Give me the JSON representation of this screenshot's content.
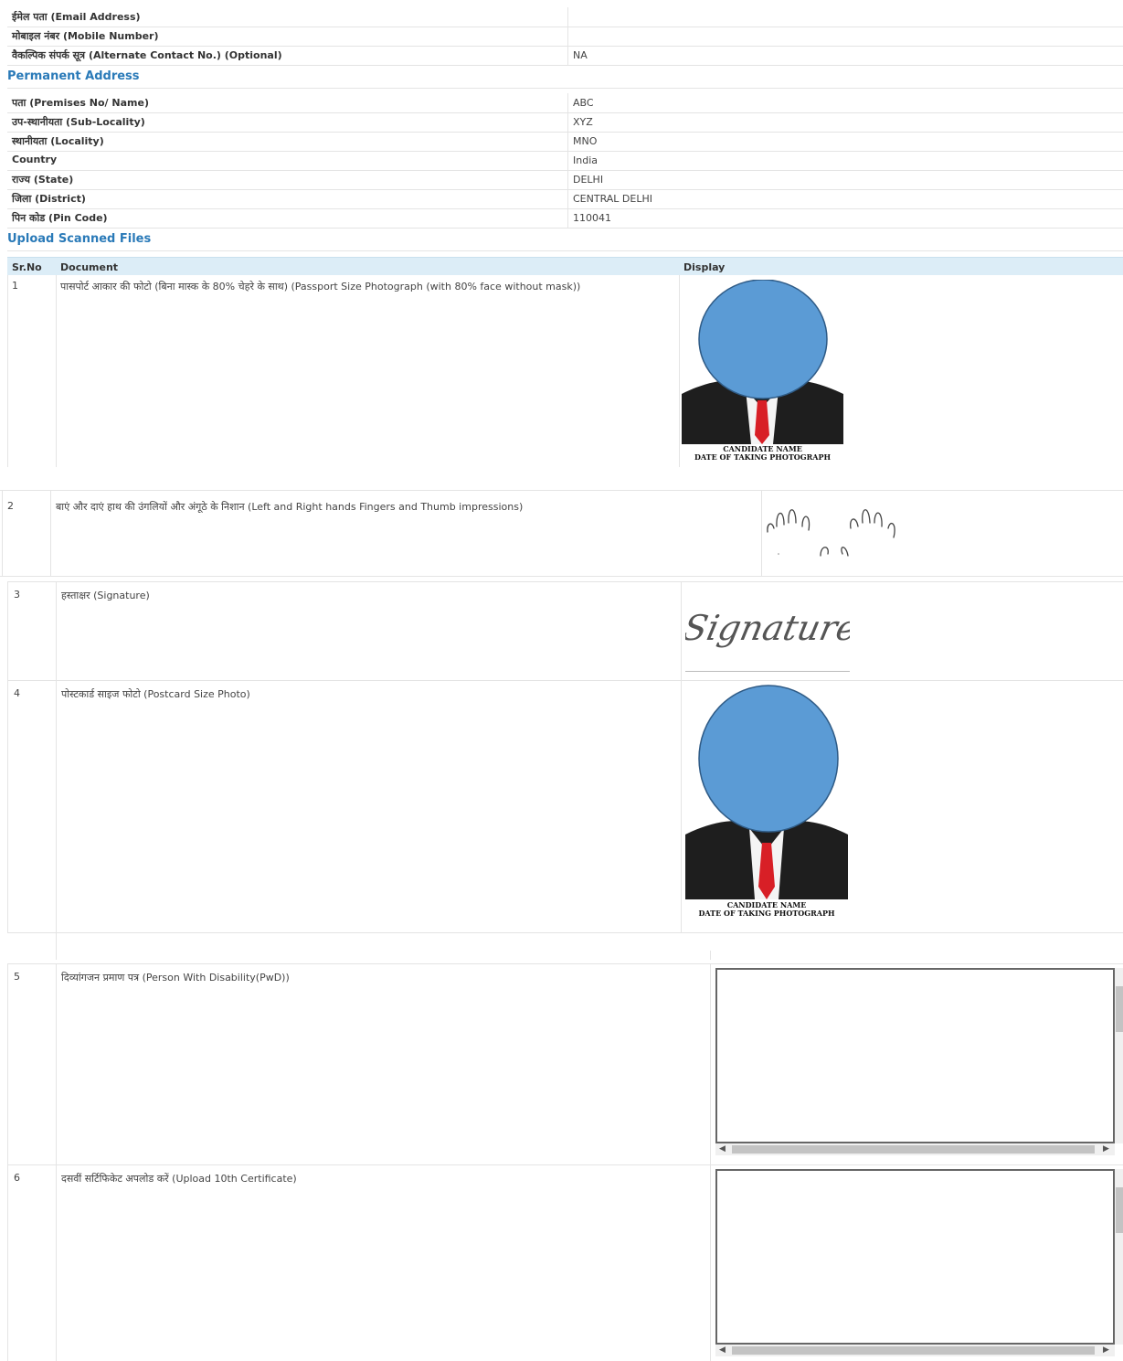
{
  "contact": {
    "rows": [
      {
        "label": "ईमेल पता (Email Address)",
        "value": ""
      },
      {
        "label": "मोबाइल नंबर (Mobile Number)",
        "value": ""
      },
      {
        "label": "वैकल्पिक संपर्क सूत्र (Alternate Contact No.) (Optional)",
        "value": "NA"
      }
    ]
  },
  "permanent_address": {
    "title": "Permanent Address",
    "rows": [
      {
        "label": "पता (Premises No/ Name)",
        "value": "ABC"
      },
      {
        "label": "उप-स्थानीयता (Sub-Locality)",
        "value": "XYZ"
      },
      {
        "label": "स्थानीयता (Locality)",
        "value": "MNO"
      },
      {
        "label": "Country",
        "value": "India"
      },
      {
        "label": "राज्य (State)",
        "value": "DELHI"
      },
      {
        "label": "जिला (District)",
        "value": "CENTRAL DELHI"
      },
      {
        "label": "पिन कोड (Pin Code)",
        "value": "110041"
      }
    ]
  },
  "uploads": {
    "title": "Upload Scanned Files",
    "headers": {
      "srno": "Sr.No",
      "document": "Document",
      "display": "Display"
    },
    "items": [
      {
        "sr": "1",
        "document": "पासपोर्ट आकार की फोटो (बिना मास्क के 80% चेहरे के साथ) (Passport Size Photograph (with 80% face without mask))",
        "display": "photo"
      },
      {
        "sr": "2",
        "document": "बाएं और दाएं हाथ की उंगलियों और अंगूठे के निशान (Left and Right hands Fingers and Thumb impressions)",
        "display": "fingerprints"
      },
      {
        "sr": "3",
        "document": "हस्ताक्षर (Signature)",
        "display": "signature"
      },
      {
        "sr": "4",
        "document": "पोस्टकार्ड साइज फोटो (Postcard Size Photo)",
        "display": "photo"
      },
      {
        "sr": "5",
        "document": "दिव्यांगजन प्रमाण पत्र (Person With Disability(PwD))",
        "display": "document-viewer"
      },
      {
        "sr": "6",
        "document": "दसवीं सर्टिफिकेट अपलोड करें (Upload 10th Certificate)",
        "display": "document-viewer"
      }
    ],
    "photo_caption": {
      "line1": "CANDIDATE NAME",
      "line2": "DATE  OF TAKING PHOTOGRAPH"
    },
    "signature_text": "Signature"
  },
  "colors": {
    "section_title": "#2a7ab8",
    "header_bg": "#dcedf7",
    "face_blur": "#5b9bd5",
    "tie": "#d81f26",
    "suit": "#1e1e1e"
  }
}
